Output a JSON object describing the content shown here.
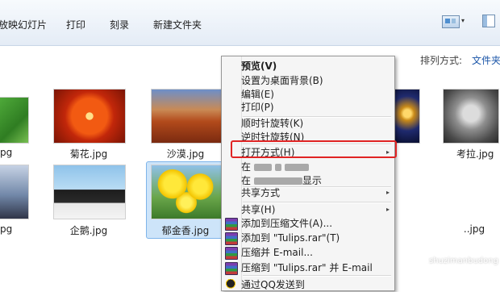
{
  "toolbar": {
    "slideshow_label": "放映幻灯片",
    "print_label": "打印",
    "burn_label": "刻录",
    "new_folder_label": "新建文件夹",
    "view_arrow": "▾"
  },
  "arrange": {
    "label": "排列方式:",
    "value": "文件夹"
  },
  "files": {
    "row1": [
      "jpg",
      "菊花.jpg",
      "沙漠.jpg",
      "考拉.jpg"
    ],
    "row2": [
      "jpg",
      "企鹅.jpg",
      "郁金香.jpg",
      "..jpg"
    ]
  },
  "context_menu": {
    "preview": "预览(V)",
    "set_background": "设置为桌面背景(B)",
    "edit": "编辑(E)",
    "print": "打印(P)",
    "rotate_cw": "顺时针旋转(K)",
    "rotate_ccw": "逆时针旋转(N)",
    "open_with": "打开方式(H)",
    "blurred_1_prefix": "在",
    "blurred_2_prefix": "在",
    "blurred_2_suffix": "显示",
    "share_with": "共享方式",
    "share": "共享(H)",
    "add_to_archive": "添加到压缩文件(A)...",
    "add_to_tulips_rar": "添加到 \"Tulips.rar\"(T)",
    "compress_email": "压缩并 E-mail...",
    "compress_tulips_email": "压缩到 \"Tulips.rar\" 并 E-mail",
    "send_via_qq": "通过QQ发送到",
    "submenu_arrow": "▸"
  },
  "watermark": "shuzimanbudong"
}
